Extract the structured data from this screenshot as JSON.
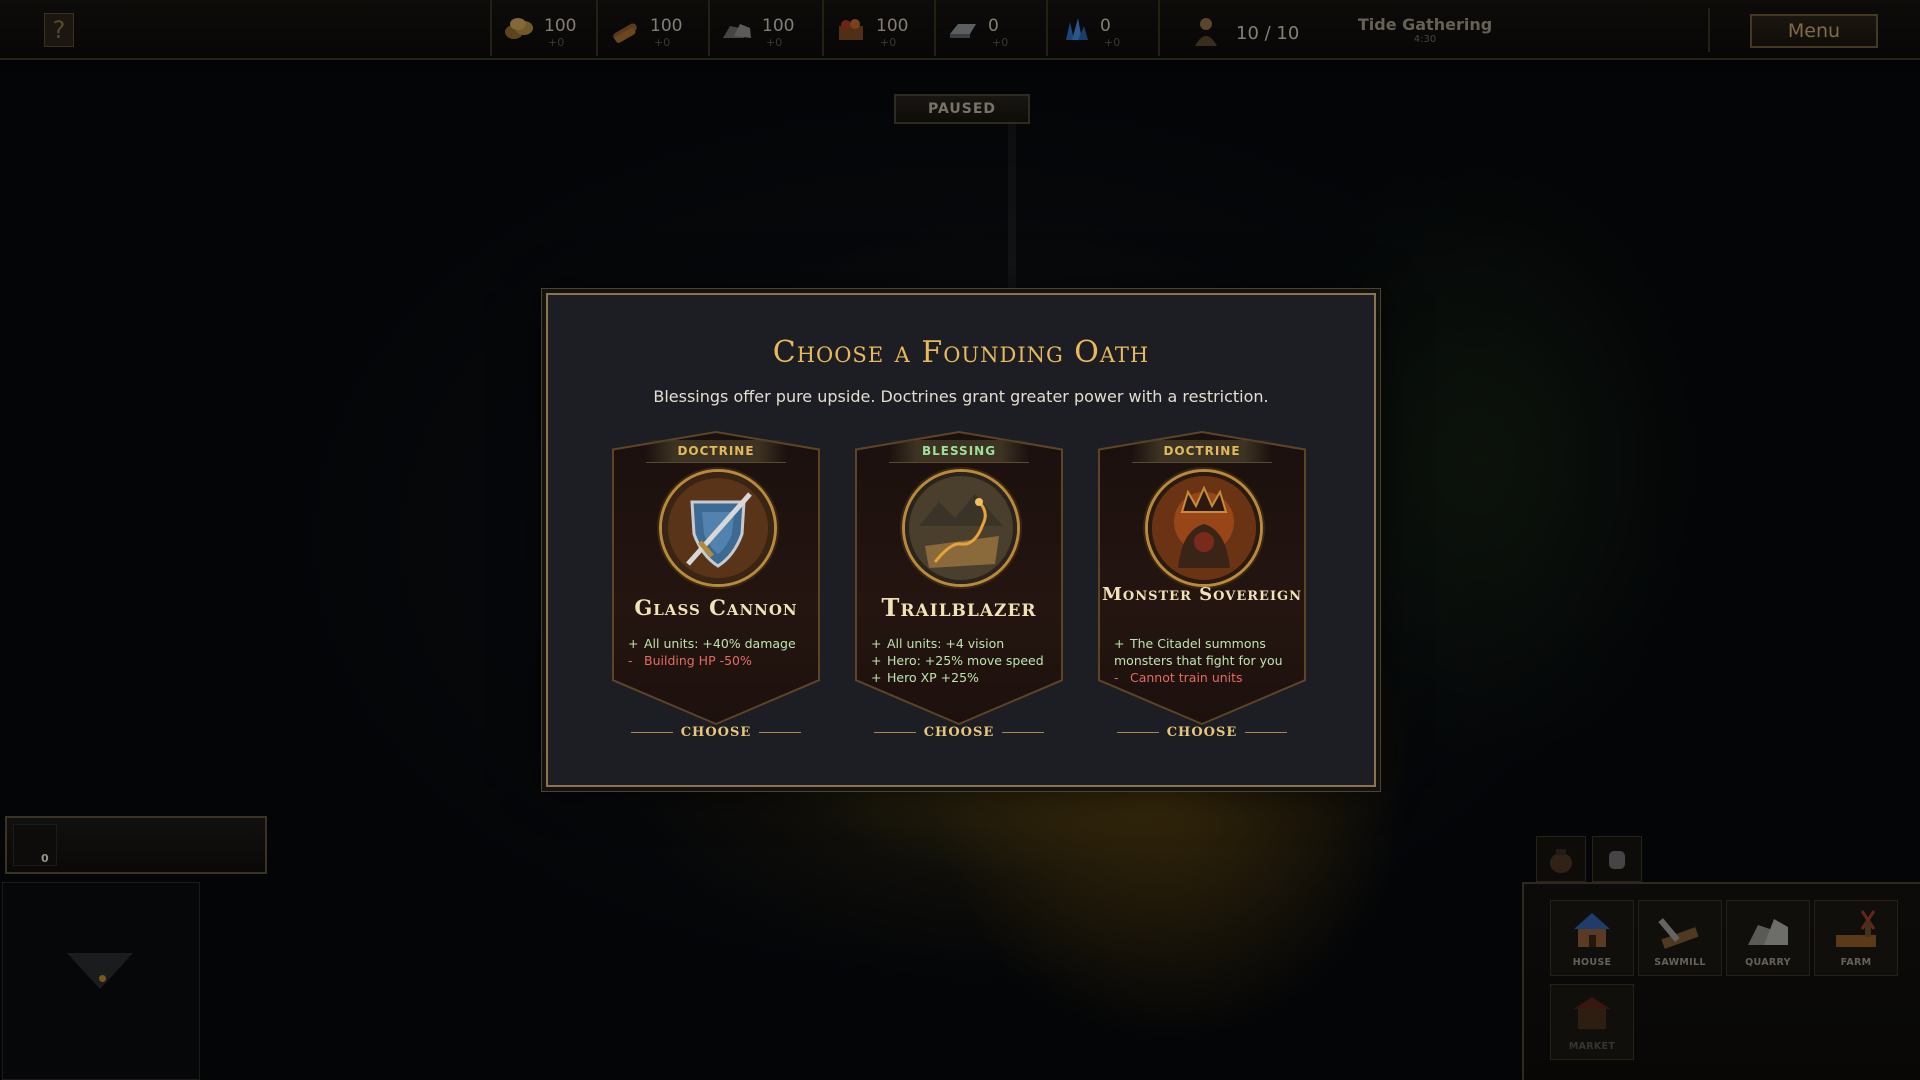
{
  "topbar": {
    "help_glyph": "?",
    "resources": [
      {
        "name": "gold",
        "icon": "gold-coins-icon",
        "value": "100",
        "delta": "+0"
      },
      {
        "name": "wood",
        "icon": "wood-logs-icon",
        "value": "100",
        "delta": "+0"
      },
      {
        "name": "stone",
        "icon": "stone-icon",
        "value": "100",
        "delta": "+0"
      },
      {
        "name": "food",
        "icon": "food-crate-icon",
        "value": "100",
        "delta": "+0"
      },
      {
        "name": "iron",
        "icon": "iron-ingot-icon",
        "value": "0",
        "delta": "+0"
      },
      {
        "name": "crystal",
        "icon": "crystal-icon",
        "value": "0",
        "delta": "+0"
      }
    ],
    "population": "10 / 10",
    "season_name": "Tide Gathering",
    "season_time": "4:30",
    "menu_label": "Menu"
  },
  "status": {
    "paused_label": "PAUSED"
  },
  "modal": {
    "title": "Choose a Founding Oath",
    "subtitle": "Blessings offer pure upside. Doctrines grant greater power with a restriction.",
    "cards": [
      {
        "tag": "DOCTRINE",
        "name": "Glass Cannon",
        "emblem": "shield-sword-icon",
        "effects": [
          {
            "sign": "+",
            "text": "All units: +40% damage",
            "kind": "positive"
          },
          {
            "sign": "-",
            "text": "Building HP -50%",
            "kind": "negative"
          }
        ],
        "button": "CHOOSE"
      },
      {
        "tag": "BLESSING",
        "name": "Trailblazer",
        "emblem": "map-scroll-icon",
        "effects": [
          {
            "sign": "+",
            "text": "All units: +4 vision",
            "kind": "positive"
          },
          {
            "sign": "+",
            "text": "Hero: +25% move speed",
            "kind": "positive"
          },
          {
            "sign": "+",
            "text": "Hero XP +25%",
            "kind": "positive"
          }
        ],
        "button": "CHOOSE"
      },
      {
        "tag": "DOCTRINE",
        "name": "Monster Sovereign",
        "emblem": "crowned-monster-icon",
        "effects": [
          {
            "sign": "+",
            "text": "The Citadel summons monsters that fight for you",
            "kind": "positive"
          },
          {
            "sign": "-",
            "text": "Cannot train units",
            "kind": "negative"
          }
        ],
        "button": "CHOOSE"
      }
    ]
  },
  "hud": {
    "unit_count": "0"
  },
  "build_menu": {
    "items": [
      {
        "label": "HOUSE",
        "icon": "house-icon"
      },
      {
        "label": "SAWMILL",
        "icon": "sawmill-icon"
      },
      {
        "label": "QUARRY",
        "icon": "quarry-icon"
      },
      {
        "label": "FARM",
        "icon": "farm-windmill-icon"
      },
      {
        "label": "MARKET",
        "icon": "market-icon"
      }
    ]
  },
  "colors": {
    "title_gold": "#e8b85c",
    "positive_effect": "#bfe4b0",
    "negative_effect": "#e46b61",
    "blessing_tag": "#9ee09a",
    "doctrine_tag": "#e3b960"
  }
}
